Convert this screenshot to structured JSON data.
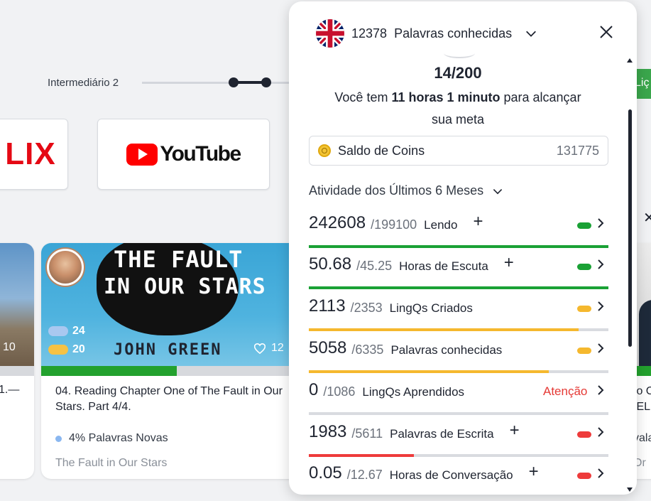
{
  "background": {
    "level_label": "Intermediário 2",
    "netflix_logo": "LIX",
    "youtube_logo": "YouTube",
    "green_button_label": "Liç",
    "left_card": {
      "count": "10",
      "title_fragment": "1.—"
    },
    "main_card": {
      "cover_title_line1": "THE FAULT",
      "cover_title_line2": "IN OUR STARS",
      "cover_author": "JOHN GREEN",
      "blue_count": "24",
      "yellow_count": "20",
      "likes": "12",
      "progress": 0.52,
      "title": "04. Reading Chapter One of The Fault in Our Stars. Part 4/4.",
      "new_words": "4% Palavras Novas",
      "course": "The Fault in Our Stars"
    },
    "right_card": {
      "line1": "to C",
      "line2": "IEL",
      "line3": "vala",
      "line4": "Or"
    }
  },
  "panel": {
    "known_words_count": "12378",
    "known_words_label": "Palavras conhecidas",
    "goal_fraction": "14/200",
    "goal_text_prefix": "Você tem ",
    "goal_time": "11 horas 1 minuto",
    "goal_text_suffix": " para alcançar sua meta",
    "coins_label": "Saldo de Coins",
    "coins_value": "131775",
    "activity_label": "Atividade dos Últimos 6 Meses",
    "stats": [
      {
        "value": "242608",
        "goal": "/199100",
        "name": "Lendo",
        "plus": "+",
        "status": "green",
        "progress": 1.0
      },
      {
        "value": "50.68",
        "goal": "/45.25",
        "name": "Horas de Escuta",
        "plus": "+",
        "status": "green",
        "progress": 1.0
      },
      {
        "value": "2113",
        "goal": "/2353",
        "name": "LingQs Criados",
        "plus": "",
        "status": "yellow",
        "progress": 0.9
      },
      {
        "value": "5058",
        "goal": "/6335",
        "name": "Palavras conhecidas",
        "plus": "",
        "status": "yellow",
        "progress": 0.8
      },
      {
        "value": "0",
        "goal": "/1086",
        "name": "LingQs Aprendidos",
        "plus": "",
        "warning": "Atenção",
        "status": "none",
        "progress": 0
      },
      {
        "value": "1983",
        "goal": "/5611",
        "name": "Palavras de Escrita",
        "plus": "+",
        "status": "red",
        "progress": 0.35
      },
      {
        "value": "0.05",
        "goal": "/12.67",
        "name": "Horas de Conversação",
        "plus": "+",
        "status": "red",
        "progress": 0.0
      }
    ]
  },
  "colors": {
    "green": "#1aa135",
    "yellow": "#f5b82e",
    "red": "#ee3b3b",
    "accent": "#1f2430"
  }
}
